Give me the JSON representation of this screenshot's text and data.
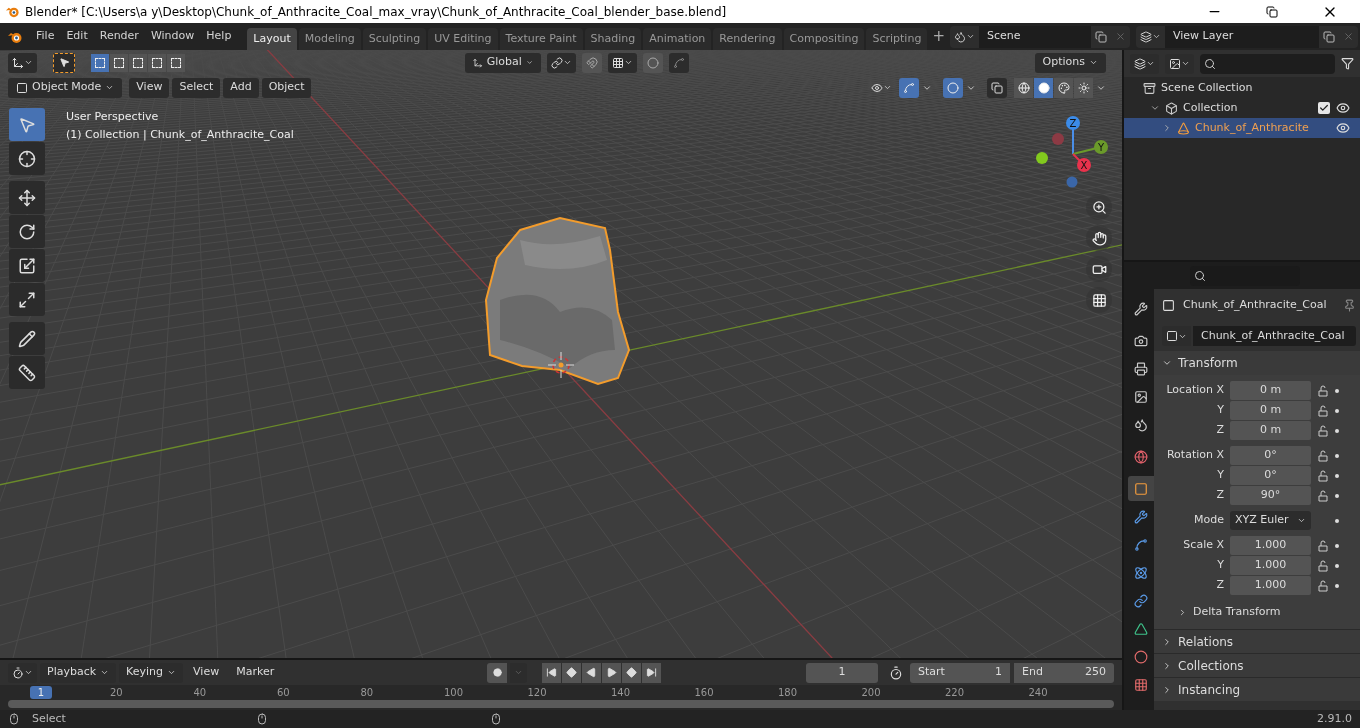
{
  "window": {
    "title": "Blender* [C:\\Users\\a y\\Desktop\\Chunk_of_Anthracite_Coal_max_vray\\Chunk_of_Anthracite_Coal_blender_base.blend]"
  },
  "menus": [
    "File",
    "Edit",
    "Render",
    "Window",
    "Help"
  ],
  "workspaces": [
    {
      "label": "Layout",
      "selected": true
    },
    {
      "label": "Modeling",
      "selected": false
    },
    {
      "label": "Sculpting",
      "selected": false
    },
    {
      "label": "UV Editing",
      "selected": false
    },
    {
      "label": "Texture Paint",
      "selected": false
    },
    {
      "label": "Shading",
      "selected": false
    },
    {
      "label": "Animation",
      "selected": false
    },
    {
      "label": "Rendering",
      "selected": false
    },
    {
      "label": "Compositing",
      "selected": false
    },
    {
      "label": "Scripting",
      "selected": false
    }
  ],
  "add_workspace": "+",
  "scene": "Scene",
  "view_layer": "View Layer",
  "viewport": {
    "select_modes": [
      {
        "selected": true
      },
      {
        "selected": false
      },
      {
        "selected": false
      },
      {
        "selected": false
      },
      {
        "selected": false
      }
    ],
    "orientation": "Global",
    "options": "Options",
    "mode": "Object Mode",
    "header_menus": [
      "View",
      "Select",
      "Add",
      "Object"
    ],
    "shading_modes": [
      {
        "selected": false
      },
      {
        "selected": true
      },
      {
        "selected": false
      },
      {
        "selected": false
      }
    ],
    "overlay_text": [
      "User Perspective",
      "(1) Collection | Chunk_of_Anthracite_Coal"
    ],
    "tools": [
      {
        "selected": true
      },
      {
        "selected": false
      },
      {
        "selected": false
      },
      {
        "selected": false
      },
      {
        "selected": false
      },
      {
        "selected": false
      },
      {
        "selected": false
      },
      {
        "selected": false
      }
    ],
    "gizmo_axes": [
      "Z",
      "Y",
      "X"
    ]
  },
  "outliner": {
    "items": [
      {
        "label": "Scene Collection",
        "kind": "scene",
        "selected": false,
        "children": [
          {
            "label": "Collection",
            "kind": "collection",
            "selected": false,
            "checked": true,
            "expanded": true,
            "children": [
              {
                "label": "Chunk_of_Anthracite",
                "kind": "object",
                "selected": true,
                "expanded": false
              }
            ]
          }
        ]
      }
    ]
  },
  "properties": {
    "tabs": [
      {
        "selected": false
      },
      {
        "selected": false
      },
      {
        "selected": false
      },
      {
        "selected": false
      },
      {
        "selected": false
      },
      {
        "selected": false
      },
      {
        "selected": true
      },
      {
        "selected": false
      },
      {
        "selected": false
      },
      {
        "selected": false
      },
      {
        "selected": false
      },
      {
        "selected": false
      },
      {
        "selected": false
      },
      {
        "selected": false
      }
    ],
    "object_name": "Chunk_of_Anthracite_Coal",
    "name_field": "Chunk_of_Anthracite_Coal",
    "transform": {
      "title": "Transform",
      "expanded": true,
      "groups": [
        {
          "kind": "vector",
          "rows": [
            {
              "label": "Location X",
              "value": "0 m"
            },
            {
              "label": "Y",
              "value": "0 m"
            },
            {
              "label": "Z",
              "value": "0 m"
            }
          ]
        },
        {
          "kind": "vector",
          "rows": [
            {
              "label": "Rotation X",
              "value": "0°"
            },
            {
              "label": "Y",
              "value": "0°"
            },
            {
              "label": "Z",
              "value": "90°"
            }
          ]
        },
        {
          "kind": "dropdown",
          "rows": [
            {
              "label": "Mode",
              "value": "XYZ Euler"
            }
          ]
        },
        {
          "kind": "vector",
          "rows": [
            {
              "label": "Scale X",
              "value": "1.000"
            },
            {
              "label": "Y",
              "value": "1.000"
            },
            {
              "label": "Z",
              "value": "1.000"
            }
          ]
        }
      ],
      "subpanel": {
        "title": "Delta Transform",
        "expanded": false
      }
    },
    "panels": [
      {
        "title": "Relations",
        "expanded": false
      },
      {
        "title": "Collections",
        "expanded": false
      },
      {
        "title": "Instancing",
        "expanded": false
      }
    ]
  },
  "timeline": {
    "menus": [
      "Playback",
      "Keying",
      "View",
      "Marker"
    ],
    "current_frame": "1",
    "start_label": "Start",
    "start": "1",
    "end_label": "End",
    "end": "250",
    "ruler_marker": "1",
    "ticks": [
      "20",
      "40",
      "60",
      "80",
      "100",
      "120",
      "140",
      "160",
      "180",
      "200",
      "220",
      "240"
    ]
  },
  "status": {
    "action": "Select",
    "version": "2.91.0"
  }
}
